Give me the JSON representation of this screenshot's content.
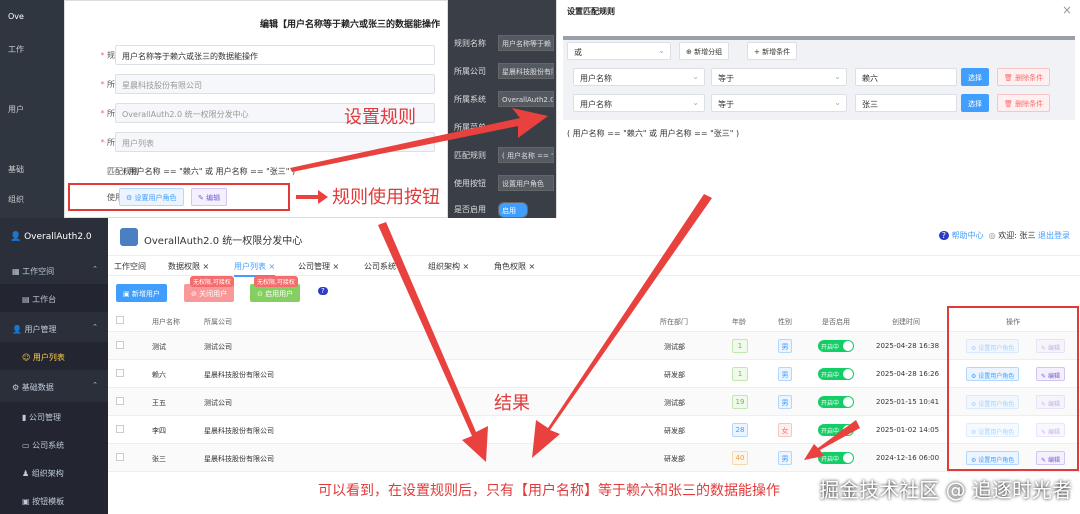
{
  "bg_sidebar": {
    "brand": "Ove",
    "items": [
      "工作",
      "用户",
      "基础",
      "组织"
    ]
  },
  "rule_dialog": {
    "title": "编辑【用户名称等于赖六或张三的数据能操作",
    "fields": [
      {
        "label": "规则名称",
        "value": "用户名称等于赖六或张三的数据能操作",
        "required": true
      },
      {
        "label": "所属公司",
        "value": "星晨科技股份有限公司",
        "required": true
      },
      {
        "label": "所属系统",
        "value": "OverallAuth2.0 统一权限分发中心",
        "required": true
      },
      {
        "label": "所属菜单",
        "value": "用户列表",
        "required": true
      },
      {
        "label": "匹配规则",
        "value": "( 用户名称 == \"赖六\" 或 用户名称 == \"张三\" )",
        "required": false
      }
    ],
    "use_button_label": "使用按钮",
    "btn_set_role": "设置用户角色",
    "btn_edit": "编辑"
  },
  "mid_bg": {
    "rows": [
      {
        "label": "规则名称",
        "value": "用户名称等于赖"
      },
      {
        "label": "所属公司",
        "value": "星晨科技股份有限"
      },
      {
        "label": "所属系统",
        "value": "OverallAuth2.0 统"
      },
      {
        "label": "所属菜单",
        "value": ""
      },
      {
        "label": "匹配规则",
        "value": "( 用户名称 == \""
      },
      {
        "label": "使用按钮",
        "value": "设置用户角色"
      },
      {
        "label": "是否启用",
        "value": "启用"
      }
    ]
  },
  "match_dialog": {
    "title": "设置匹配规则",
    "logic": "或",
    "btn_add_group": "新增分组",
    "btn_add_cond": "新增条件",
    "conditions": [
      {
        "field": "用户名称",
        "op": "等于",
        "value": "赖六"
      },
      {
        "field": "用户名称",
        "op": "等于",
        "value": "张三"
      }
    ],
    "btn_select": "选择",
    "btn_delete": "删除条件",
    "expression": "( 用户名称 == \"赖六\" 或 用户名称 == \"张三\" )"
  },
  "app": {
    "brand": "OverallAuth2.0",
    "title": "OverallAuth2.0 统一权限分发中心",
    "help": "帮助中心",
    "welcome": "欢迎: 张三",
    "logout": "退出登录",
    "menu": [
      {
        "label": "工作空间",
        "level": 1,
        "chev": "⌃"
      },
      {
        "label": "工作台",
        "level": 2
      },
      {
        "label": "用户管理",
        "level": 1,
        "chev": "⌃"
      },
      {
        "label": "用户列表",
        "level": 2,
        "active": true
      },
      {
        "label": "基础数据",
        "level": 1,
        "chev": "⌃"
      },
      {
        "label": "公司管理",
        "level": 2
      },
      {
        "label": "公司系统",
        "level": 2
      },
      {
        "label": "组织架构",
        "level": 2
      },
      {
        "label": "按钮模板",
        "level": 2
      }
    ],
    "tabs": [
      {
        "label": "工作空间",
        "close": false
      },
      {
        "label": "数据权限",
        "close": true
      },
      {
        "label": "用户列表",
        "close": true,
        "active": true
      },
      {
        "label": "公司管理",
        "close": true
      },
      {
        "label": "公司系统",
        "close": true
      },
      {
        "label": "组织架构",
        "close": true
      },
      {
        "label": "角色权限",
        "close": true
      }
    ],
    "tools": {
      "add": "新增用户",
      "disable": "关闭用户",
      "enable": "启用用户",
      "badge": "无权限,可接权",
      "help": "?"
    },
    "columns": [
      "用户名称",
      "所属公司",
      "所在部门",
      "年龄",
      "性别",
      "是否启用",
      "创建时间",
      "操作"
    ],
    "rows": [
      {
        "name": "测试",
        "company": "测试公司",
        "dept": "测试部",
        "age": "1",
        "sex": "男",
        "enabled": "开启中",
        "created": "2025-04-28 16:38",
        "ops_enabled": false
      },
      {
        "name": "赖六",
        "company": "星晨科技股份有限公司",
        "dept": "研发部",
        "age": "1",
        "sex": "男",
        "enabled": "开启中",
        "created": "2025-04-28 16:26",
        "ops_enabled": true
      },
      {
        "name": "王五",
        "company": "测试公司",
        "dept": "测试部",
        "age": "19",
        "sex": "男",
        "enabled": "开启中",
        "created": "2025-01-15 10:41",
        "ops_enabled": false
      },
      {
        "name": "李四",
        "company": "星晨科技股份有限公司",
        "dept": "研发部",
        "age": "28",
        "sex": "女",
        "enabled": "开启中",
        "created": "2025-01-02 14:05",
        "ops_enabled": false
      },
      {
        "name": "张三",
        "company": "星晨科技股份有限公司",
        "dept": "研发部",
        "age": "40",
        "sex": "男",
        "enabled": "开启中",
        "created": "2024-12-16 06:00",
        "ops_enabled": true
      }
    ],
    "op_role": "设置用户角色",
    "op_edit": "编辑"
  },
  "annotations": {
    "set_rule": "设置规则",
    "rule_button": "规则使用按钮",
    "result": "结果",
    "conclusion": "可以看到，在设置规则后，只有【用户名称】等于赖六和张三的数据能操作",
    "watermark": "掘金技术社区 @ 追逐时光者"
  },
  "colors": {
    "accent": "#409eff",
    "annotation": "#e03a3a",
    "sidebar": "#2b2f3a"
  }
}
